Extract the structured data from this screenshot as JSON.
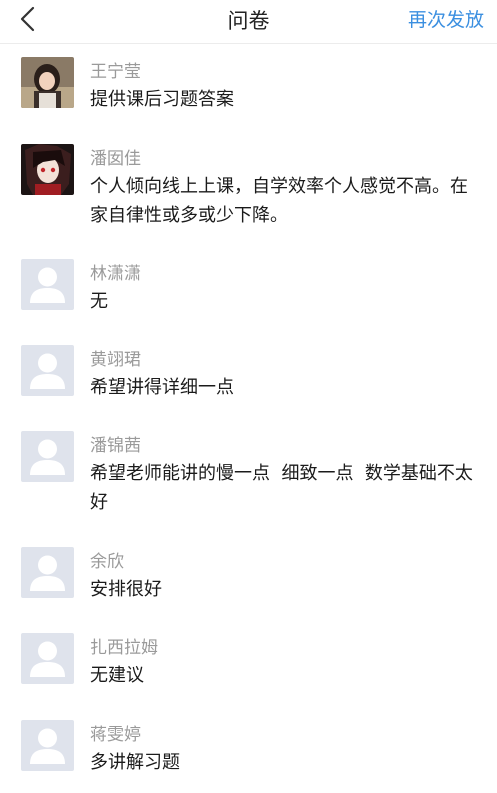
{
  "header": {
    "title": "问卷",
    "action_label": "再次发放",
    "accent_color": "#3b8fe0"
  },
  "responses": [
    {
      "name": "王宁莹",
      "text": "提供课后习题答案",
      "avatar": "photo-girl"
    },
    {
      "name": "潘囡佳",
      "text": "个人倾向线上上课，自学效率个人感觉不高。在家自律性或多或少下降。",
      "avatar": "anime-character"
    },
    {
      "name": "林潇潇",
      "text": "无",
      "avatar": "default-user"
    },
    {
      "name": "黄翊珺",
      "text": "希望讲得详细一点",
      "avatar": "default-user"
    },
    {
      "name": "潘锦茜",
      "text": "希望老师能讲的慢一点  细致一点  数学基础不太好",
      "avatar": "default-user"
    },
    {
      "name": "余欣",
      "text": "安排很好",
      "avatar": "default-user"
    },
    {
      "name": "扎西拉姆",
      "text": "无建议",
      "avatar": "default-user"
    },
    {
      "name": "蒋雯婷",
      "text": "多讲解习题",
      "avatar": "default-user"
    }
  ]
}
